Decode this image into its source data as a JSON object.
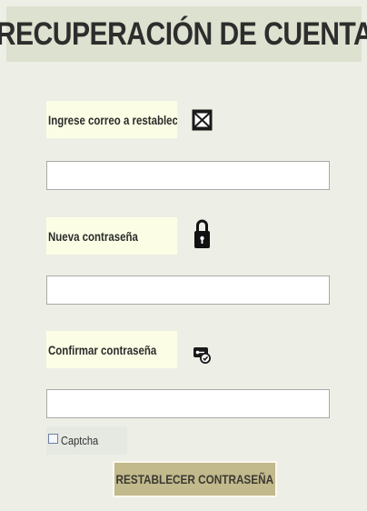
{
  "header": {
    "title": "RECUPERACIÓN DE CUENTA"
  },
  "form": {
    "email": {
      "label": "Ingrese correo a restablecer",
      "value": "",
      "placeholder": "",
      "icon": "envelope-icon"
    },
    "new_password": {
      "label": "Nueva contraseña",
      "value": "",
      "placeholder": "",
      "icon": "lock-icon"
    },
    "confirm_password": {
      "label": "Confirmar contraseña",
      "value": "",
      "placeholder": "",
      "icon": "key-shield-icon"
    },
    "captcha": {
      "label": "Captcha",
      "checked": false
    },
    "submit": {
      "label": "RESTABLECER CONTRASEÑA"
    }
  },
  "colors": {
    "page_background": "#edefe6",
    "header_background": "#dde1cf",
    "label_background": "#fbfee5",
    "button_background": "#c2b98c"
  }
}
